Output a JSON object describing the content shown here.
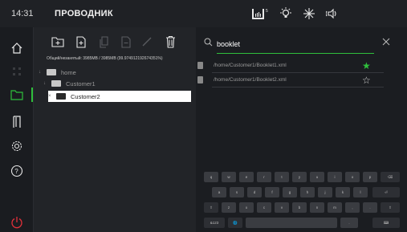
{
  "topbar": {
    "time": "14:31",
    "title": "ПРОВОДНИК",
    "status_icons": [
      "print-status-icon",
      "light-icon",
      "snowflake-icon",
      "speaker-icon"
    ]
  },
  "sidebar": {
    "items": [
      "home-icon",
      "network-icon",
      "folder-icon",
      "door-icon",
      "settings-icon",
      "help-icon"
    ],
    "active": "folder-icon",
    "power": "power-icon"
  },
  "toolbar": {
    "buttons": [
      "new-folder-icon",
      "new-file-icon",
      "copy-icon",
      "paste-icon",
      "rename-icon",
      "delete-icon"
    ],
    "enabled": [
      true,
      true,
      false,
      false,
      false,
      true
    ]
  },
  "disk_info": "Общий/незанятый: 3985MB / 3985MB (99.974912192674351%)",
  "tree": {
    "items": [
      {
        "label": "home",
        "arrow": "↓",
        "level": 0,
        "selected": false
      },
      {
        "label": "Customer1",
        "arrow": "↓",
        "level": 1,
        "selected": false
      },
      {
        "label": "Customer2",
        "arrow": "×",
        "level": 2,
        "selected": true
      }
    ]
  },
  "search": {
    "value": "booklet",
    "placeholder": ""
  },
  "results": [
    {
      "path": "/home/Customer1/Booklet1.xml",
      "favorite": true
    },
    {
      "path": "/home/Customer1/Booklet2.xml",
      "favorite": false
    }
  ],
  "keyboard": {
    "row1": [
      "q",
      "w",
      "e",
      "r",
      "t",
      "y",
      "u",
      "i",
      "o",
      "p",
      "⌫"
    ],
    "row2": [
      "a",
      "s",
      "d",
      "f",
      "g",
      "h",
      "j",
      "k",
      "l",
      "⏎"
    ],
    "row3": [
      "⇧",
      "z",
      "x",
      "c",
      "v",
      "b",
      "n",
      "m",
      ",",
      ".",
      "⇧"
    ],
    "row4": [
      "&123",
      "🌐",
      "",
      ".",
      "⌨"
    ]
  },
  "colors": {
    "accent": "#2fbf3c",
    "power": "#e0303a",
    "bg": "#1a1c20",
    "panel": "#222428"
  }
}
